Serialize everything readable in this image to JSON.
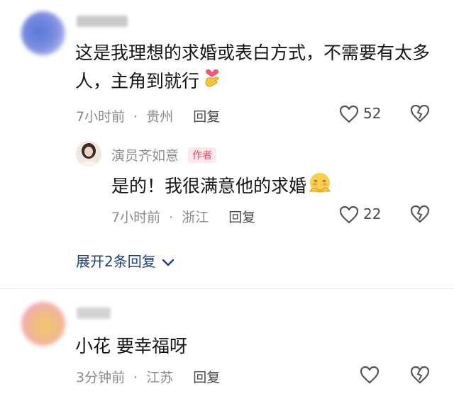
{
  "comments": [
    {
      "text": "这是我理想的求婚或表白方式，不需要有太多人，主角到就行",
      "emoji_icon": "heart-hand-icon",
      "time": "7小时前",
      "sep": "·",
      "location": "贵州",
      "reply_label": "回复",
      "likes": "52",
      "reply": {
        "author": "演员齐如意",
        "badge": "作者",
        "text": "是的！我很满意他的求婚",
        "emoji_icon": "shy-face-icon",
        "time": "7小时前",
        "sep": "·",
        "location": "浙江",
        "reply_label": "回复",
        "likes": "22"
      },
      "expand_label": "展开2条回复"
    },
    {
      "text": "小花 要幸福呀",
      "time": "3分钟前",
      "sep": "·",
      "location": "江苏",
      "reply_label": "回复"
    }
  ],
  "colors": {
    "author_badge": "#f0466c",
    "expand_link": "#1f3f7a"
  }
}
